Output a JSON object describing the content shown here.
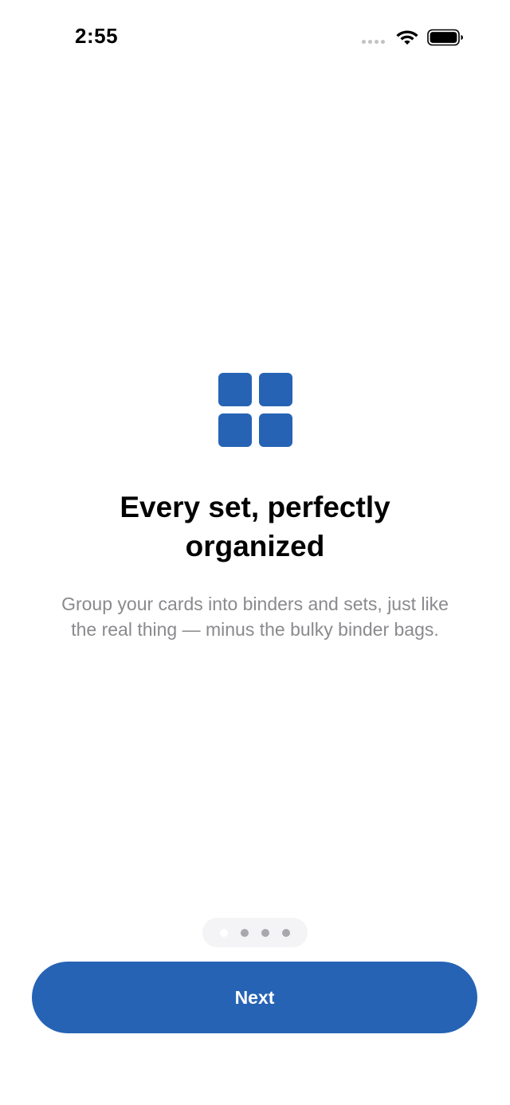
{
  "status_bar": {
    "time": "2:55",
    "icons": [
      "signal-dots-icon",
      "wifi-icon",
      "battery-icon"
    ]
  },
  "onboarding": {
    "icon": "grid-icon",
    "headline": "Every set, perfectly organized",
    "body": "Group your cards into binders and sets, just like the real thing — minus the bulky binder bags.",
    "page_count": 4,
    "current_page": 1,
    "next_label": "Next"
  },
  "colors": {
    "accent": "#2663b4",
    "body_text": "#8a8a8e",
    "pager_background": "#f4f4f6",
    "pager_dot": "#a8a8ad",
    "pager_dot_active": "#ffffff"
  }
}
